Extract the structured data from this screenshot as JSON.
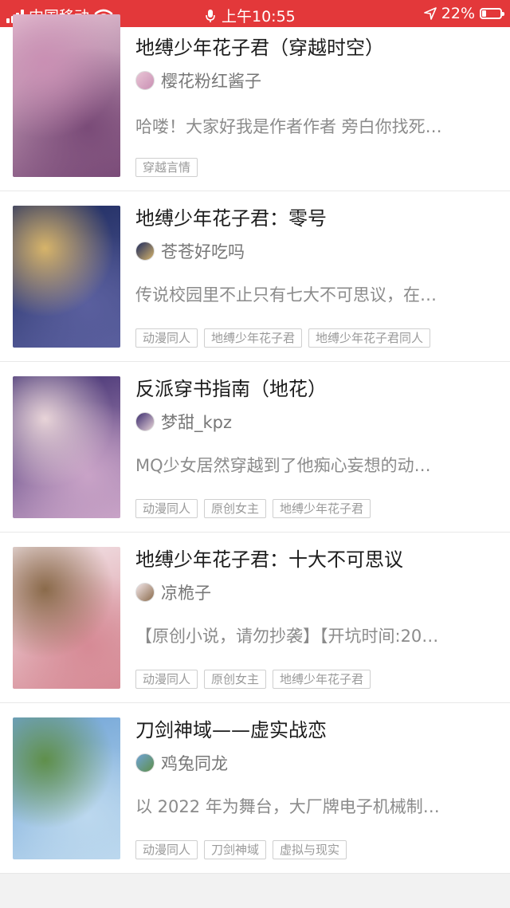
{
  "status_bar": {
    "carrier": "中国移动",
    "time": "上午10:55",
    "battery": "22%",
    "battery_level": 0.22
  },
  "books": [
    {
      "title": "地缚少年花子君（穿越时空）",
      "author": "樱花粉红酱子",
      "description": "哈喽！大家好我是作者作者 旁白你找死…",
      "tags": [
        "穿越言情"
      ],
      "cover_colors": [
        "#e9c6d6",
        "#7a4b78",
        "#c98fb3"
      ]
    },
    {
      "title": "地缚少年花子君：零号",
      "author": "苍苍好吃吗",
      "description": "传说校园里不止只有七大不可思议，在…",
      "tags": [
        "动漫同人",
        "地缚少年花子君",
        "地缚少年花子君同人"
      ],
      "cover_colors": [
        "#1c2a5e",
        "#5a5f9e",
        "#d7b46a"
      ]
    },
    {
      "title": "反派穿书指南（地花）",
      "author": "梦甜_kpz",
      "description": "MQ少女居然穿越到了他痴心妄想的动…",
      "tags": [
        "动漫同人",
        "原创女主",
        "地缚少年花子君"
      ],
      "cover_colors": [
        "#3b2b6e",
        "#c9a3c7",
        "#e8d4d8"
      ]
    },
    {
      "title": "地缚少年花子君：十大不可思议",
      "author": "凉桅子",
      "description": "【原创小说，请勿抄袭】【开坑时间:20…",
      "tags": [
        "动漫同人",
        "原创女主",
        "地缚少年花子君"
      ],
      "cover_colors": [
        "#f3e7ea",
        "#d68a95",
        "#8a6a4a"
      ]
    },
    {
      "title": "刀剑神域——虚实战恋",
      "author": "鸡兔同龙",
      "description": "以 2022 年为舞台，大厂牌电子机械制…",
      "tags": [
        "动漫同人",
        "刀剑神域",
        "虚拟与现实"
      ],
      "cover_colors": [
        "#6fa3d6",
        "#bcd8ee",
        "#5f8f4a"
      ]
    }
  ]
}
